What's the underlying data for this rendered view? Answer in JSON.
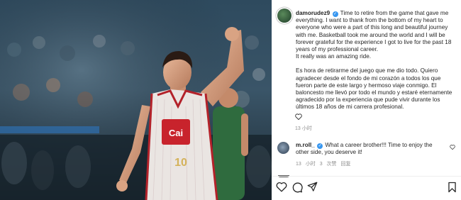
{
  "post": {
    "username": "damorudez9",
    "caption_en": "Time to retire from the game that gave me everything. I want to thank from the bottom of my heart to everyone who were a part of this long and beautiful journey with me. Basketball took me around the world and I will be forever grateful for the experience I got to live for the past 18 years of my professional career.",
    "caption_en_2": "It really was an amazing ride.",
    "caption_es": "Es hora de retirarme del juego que me dio todo. Quiero agradecer desde el fondo de mi corazón a todos los que fueron parte de este largo y hermoso viaje conmigo. El baloncesto me llevó por todo el mundo y estaré eternamente agradecido por la experiencia que pude vivir durante los últimos 18 años de mi carrera profesional.",
    "timestamp": "13 小时"
  },
  "comment": {
    "username": "m.roll_",
    "text": "What a career brother!!! Time to enjoy the other side, you deserve it!",
    "timestamp": "13 小时",
    "likes": "3 次赞",
    "reply": "回复"
  },
  "photo": {
    "jersey_brand": "Cai",
    "jersey_number": "10"
  },
  "icons": [
    "heart-icon",
    "comment-icon",
    "share-icon",
    "bookmark-icon",
    "verified-badge-icon"
  ]
}
